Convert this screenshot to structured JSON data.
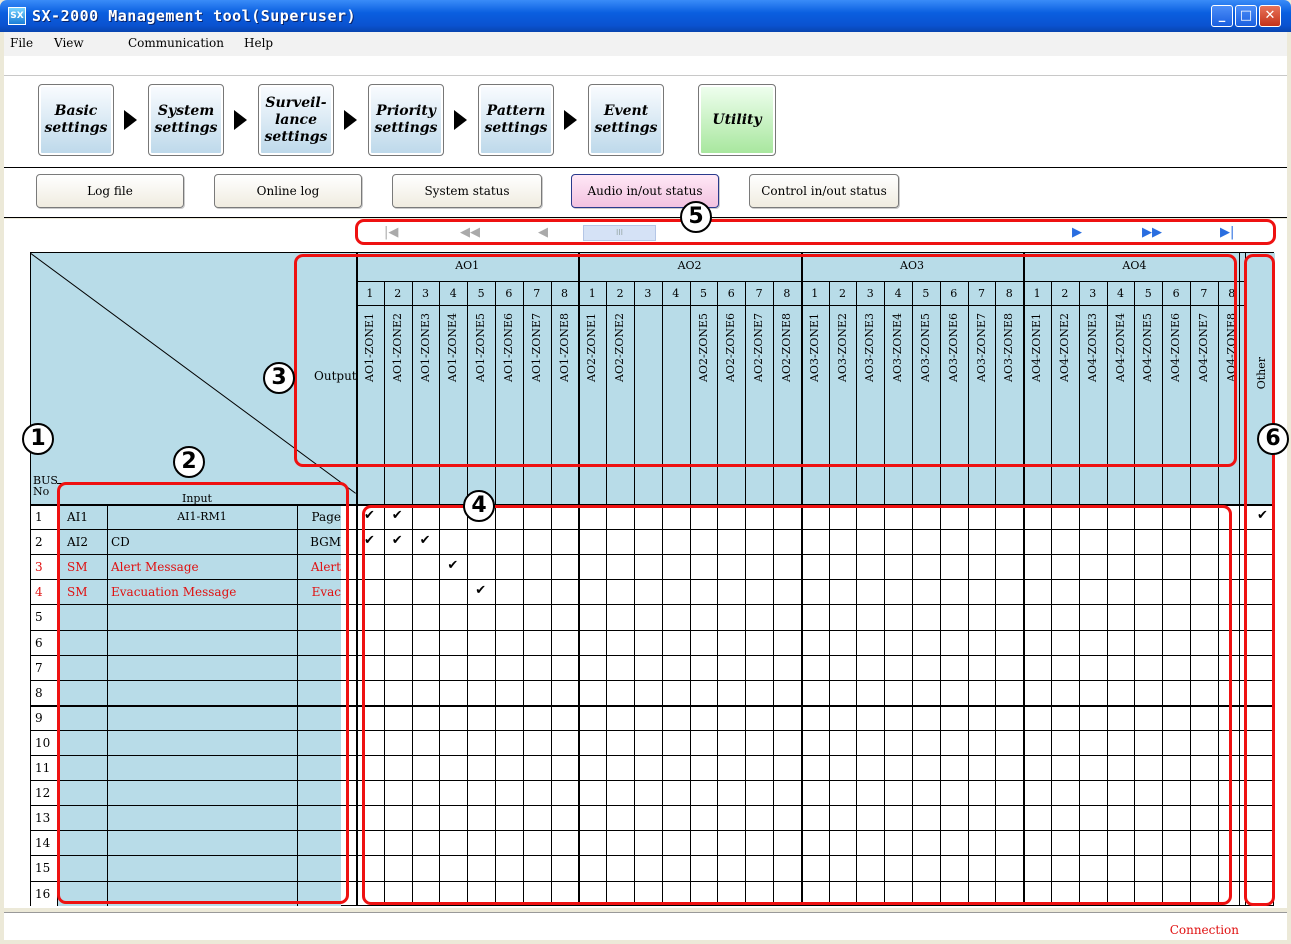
{
  "window": {
    "title": "SX-2000 Management tool(Superuser)",
    "icon": "SX"
  },
  "menu": [
    "File",
    "View",
    "Communication",
    "Help"
  ],
  "steps": [
    "Basic\nsettings",
    "System\nsettings",
    "Surveil-\nlance\nsettings",
    "Priority\nsettings",
    "Pattern\nsettings",
    "Event\nsettings",
    "Utility"
  ],
  "tabs": [
    "Log file",
    "Online log",
    "System status",
    "Audio in/out status",
    "Control in/out status"
  ],
  "active_tab": "Audio in/out status",
  "table": {
    "output_label": "Output",
    "input_label": "Input",
    "bus_label": "BUS\nNo",
    "other_label": "Other",
    "groups": [
      "AO1",
      "AO2",
      "AO3",
      "AO4"
    ],
    "channels": [
      "1",
      "2",
      "3",
      "4",
      "5",
      "6",
      "7",
      "8"
    ],
    "zones": [
      [
        "AO1-ZONE1",
        "AO1-ZONE2",
        "AO1-ZONE3",
        "AO1-ZONE4",
        "AO1-ZONE5",
        "AO1-ZONE6",
        "AO1-ZONE7",
        "AO1-ZONE8"
      ],
      [
        "AO2-ZONE1",
        "AO2-ZONE2",
        "",
        "",
        "AO2-ZONE5",
        "AO2-ZONE6",
        "AO2-ZONE7",
        "AO2-ZONE8"
      ],
      [
        "AO3-ZONE1",
        "AO3-ZONE2",
        "AO3-ZONE3",
        "AO3-ZONE4",
        "AO3-ZONE5",
        "AO3-ZONE6",
        "AO3-ZONE7",
        "AO3-ZONE8"
      ],
      [
        "AO4-ZONE1",
        "AO4-ZONE2",
        "AO4-ZONE3",
        "AO4-ZONE4",
        "AO4-ZONE5",
        "AO4-ZONE6",
        "AO4-ZONE7",
        "AO4-ZONE8"
      ]
    ],
    "rows": [
      {
        "bus": "1",
        "src": "AI1",
        "name": "AI1-RM1",
        "type": "Page",
        "red": false,
        "checks": [
          0,
          1
        ],
        "other": true
      },
      {
        "bus": "2",
        "src": "AI2",
        "name": "CD",
        "type": "BGM",
        "red": false,
        "checks": [
          0,
          1,
          2
        ],
        "other": false
      },
      {
        "bus": "3",
        "src": "SM",
        "name": "Alert Message",
        "type": "Alert",
        "red": true,
        "checks": [
          3
        ],
        "other": false
      },
      {
        "bus": "4",
        "src": "SM",
        "name": "Evacuation Message",
        "type": "Evac",
        "red": true,
        "checks": [
          4
        ],
        "other": false
      },
      {
        "bus": "5",
        "src": "",
        "name": "",
        "type": "",
        "red": false,
        "checks": [],
        "other": false
      },
      {
        "bus": "6",
        "src": "",
        "name": "",
        "type": "",
        "red": false,
        "checks": [],
        "other": false
      },
      {
        "bus": "7",
        "src": "",
        "name": "",
        "type": "",
        "red": false,
        "checks": [],
        "other": false
      },
      {
        "bus": "8",
        "src": "",
        "name": "",
        "type": "",
        "red": false,
        "checks": [],
        "other": false
      },
      {
        "bus": "9",
        "src": "",
        "name": "",
        "type": "",
        "red": false,
        "checks": [],
        "other": false
      },
      {
        "bus": "10",
        "src": "",
        "name": "",
        "type": "",
        "red": false,
        "checks": [],
        "other": false
      },
      {
        "bus": "11",
        "src": "",
        "name": "",
        "type": "",
        "red": false,
        "checks": [],
        "other": false
      },
      {
        "bus": "12",
        "src": "",
        "name": "",
        "type": "",
        "red": false,
        "checks": [],
        "other": false
      },
      {
        "bus": "13",
        "src": "",
        "name": "",
        "type": "",
        "red": false,
        "checks": [],
        "other": false
      },
      {
        "bus": "14",
        "src": "",
        "name": "",
        "type": "",
        "red": false,
        "checks": [],
        "other": false
      },
      {
        "bus": "15",
        "src": "",
        "name": "",
        "type": "",
        "red": false,
        "checks": [],
        "other": false
      },
      {
        "bus": "16",
        "src": "",
        "name": "",
        "type": "",
        "red": false,
        "checks": [],
        "other": false
      }
    ],
    "check_mark": "✔"
  },
  "callouts": [
    "1",
    "2",
    "3",
    "4",
    "5",
    "6"
  ],
  "status": "Connection",
  "colors": {
    "accent": "#0a5fe0",
    "header_fill": "#b8dce8",
    "callout": "#ee1111",
    "alert_text": "#e01010"
  }
}
